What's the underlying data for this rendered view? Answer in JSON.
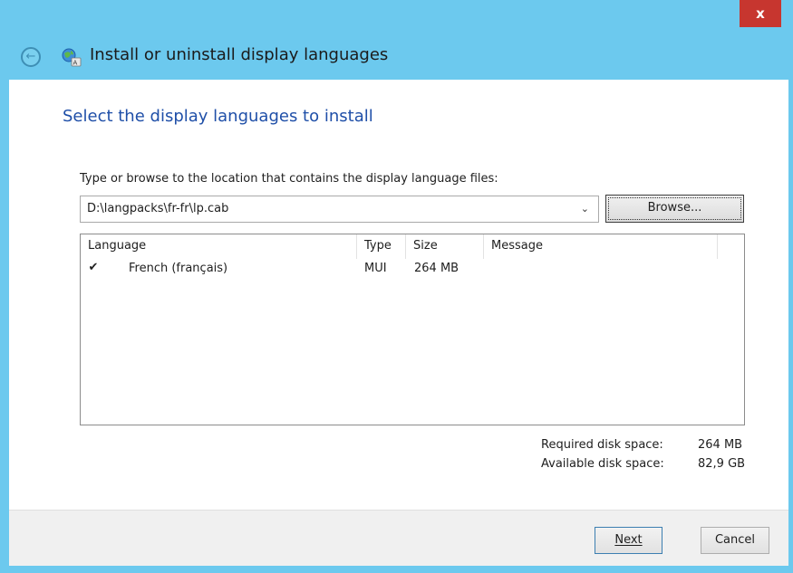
{
  "window": {
    "title": "Install or uninstall display languages",
    "close_label": "x"
  },
  "nav": {
    "back_glyph": "←"
  },
  "main": {
    "heading": "Select the display languages to install",
    "instruction": "Type or browse to the location that contains the display language files:",
    "path_value": "D:\\langpacks\\fr-fr\\lp.cab",
    "browse_label": "Browse..."
  },
  "list": {
    "columns": [
      "Language",
      "Type",
      "Size",
      "Message"
    ],
    "rows": [
      {
        "checked": true,
        "language": "French (français)",
        "type": "MUI",
        "size": "264 MB",
        "message": ""
      }
    ]
  },
  "disk": {
    "required_label": "Required disk space:",
    "required_value": "264 MB",
    "available_label": "Available disk space:",
    "available_value": "82,9 GB"
  },
  "footer": {
    "next_label": "Next",
    "cancel_label": "Cancel"
  },
  "colors": {
    "titlebar": "#6cc9ee",
    "close": "#c7362f",
    "heading": "#1f4fa8"
  },
  "icons": [
    "close-icon",
    "back-arrow-icon",
    "language-globe-icon",
    "dropdown-chevron-icon",
    "checkmark-icon"
  ]
}
